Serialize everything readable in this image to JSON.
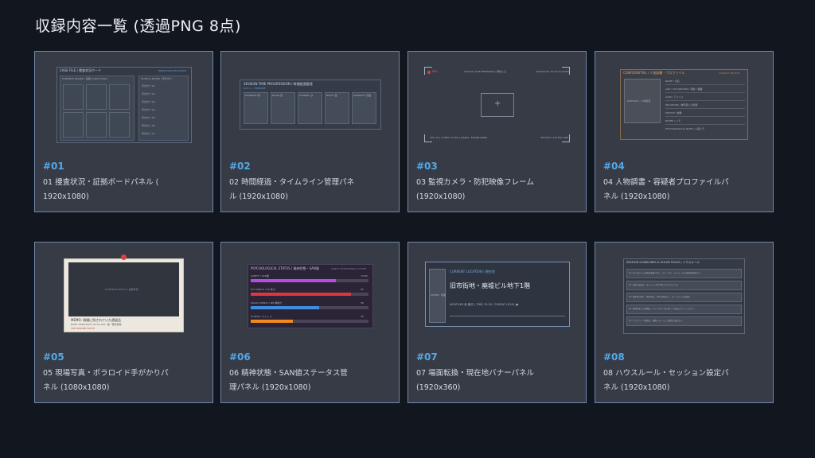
{
  "page": {
    "title": "収録内容一覧 (透過PNG 8点)"
  },
  "cards": [
    {
      "num": "#01",
      "name_line1": "01 捜査状況・証拠ボードパネル (",
      "name_line2": "1920x1080)",
      "thumb": {
        "header": "CASE FILE | 捜査状況ボード",
        "header_right": "INVESTIGATION STATUS",
        "left_panel": "EVIDENCE BOARD / 証拠 (1920×1080)",
        "right_panel": "CLUES & NOTES / 手がかり",
        "items": [
          "手がかり 01",
          "手がかり 02",
          "手がかり 03",
          "手がかり 04",
          "手がかり 05",
          "手がかり 06",
          "手がかり 07"
        ]
      }
    },
    {
      "num": "#02",
      "name_line1": "02 時間経過・タイムライン管理パネ",
      "name_line2": "ル (1920x1080)",
      "thumb": {
        "header": "SESSION TIME PROGRESSION / 時間経過管理",
        "sub": "DAY 1 — TIMELINE",
        "slots": [
          "MORNING 朝",
          "NOON 昼",
          "EVENING 夕",
          "NIGHT 夜",
          "MIDNIGHT 深夜"
        ]
      }
    },
    {
      "num": "#03",
      "name_line1": "03 監視カメラ・防犯映像フレーム",
      "name_line2": "(1920x1080)",
      "thumb": {
        "rec": "REC",
        "cam": "CAM 03 | SITE ENTRANCE | 現場入口",
        "time": "2024/10/27 23:41:15 [LIVE]",
        "footer_left": "TPS: 24 | CODEC: H.265 | SIGNAL: ESTABLISHED",
        "footer_right": "SECURITY SYSTEM LINK"
      }
    },
    {
      "num": "#04",
      "name_line1": "04 人物調書・容疑者プロファイルパ",
      "name_line2": "ネル (1920x1080)",
      "thumb": {
        "header": "CONFIDENTIAL / 人物調書 - プロファイル",
        "header_right": "SUSPECT PROFILE",
        "photo": "PORTRAIT / 人物写真",
        "fields": [
          "NAME / 氏名",
          "AGE / OCCUPATION / 年齢・職業",
          "ALIBI / アリバイ",
          "RELATIONS / 被害者との関係",
          "MOTIVE / 動機",
          "NOTES / メモ",
          "PSYCHOLOGICAL NOTE / 心理メモ"
        ]
      }
    },
    {
      "num": "#05",
      "name_line1": "05 現場写真・ポラロイド手がかりパ",
      "name_line2": "ネル (1080x1080)",
      "thumb": {
        "photo": "EVIDENCE PHOTO / 証拠写真",
        "memo": "MEMO: 現場に残されていた遺留品",
        "date": "DATE: 2024/10/27 23:52  LOC: 第一発見現場",
        "note": "THE HIDDEN TRUTH"
      }
    },
    {
      "num": "#06",
      "name_line1": "06 精神状態・SAN値ステータス管",
      "name_line2": "理パネル (1920x1080)",
      "thumb": {
        "header": "PSYCHOLOGICAL STATUS / 精神状態・SAN値",
        "header_right": "SANITY MONITORING SYSTEM",
        "bars": [
          {
            "label": "SANITY / SAN値",
            "value": 72,
            "color": "#b54de0",
            "val": "72/99"
          },
          {
            "label": "HIT POINTS / HP 体力",
            "value": 85,
            "color": "#e0353f",
            "val": "85"
          },
          {
            "label": "MAGIC POINTS / MP 精神力",
            "value": 58,
            "color": "#3e8ee0",
            "val": "58"
          },
          {
            "label": "STRESS / ストレス",
            "value": 36,
            "color": "#f08a1c",
            "val": "36"
          }
        ]
      }
    },
    {
      "num": "#07",
      "name_line1": "07 場面転換・現在地バナーパネル",
      "name_line2": "(1920x360)",
      "thumb": {
        "side": "SCENE / 場面",
        "location_label": "CURRENT LOCATION / 現在地",
        "location": "旧市街地・廃墟ビル地下1階",
        "weather": "WEATHER 雨 曇天 | TIME 23:00 | THREAT LEVEL ●"
      }
    },
    {
      "num": "#08",
      "name_line1": "08 ハウスルール・セッション設定パ",
      "name_line2": "ネル (1920x1080)",
      "thumb": {
        "header": "SESSION GUIDELINES & HOUSE RULES / ハウスルール",
        "rules": [
          "01. ダイスロールは共有画面で行い、ファンブル・クリティカル処理を確認する",
          "02. 技能の成長は、セッション終了時に行うものとする",
          "03. 探索者の死亡・発狂時は、GMと相談の上、ロールプレイを継続",
          "04. 他探索者との共闘は、キャラクター性に則って自由に行ってください",
          "05. プライベート情報は、秘匿チャットにて個別に伝達する"
        ]
      }
    }
  ]
}
